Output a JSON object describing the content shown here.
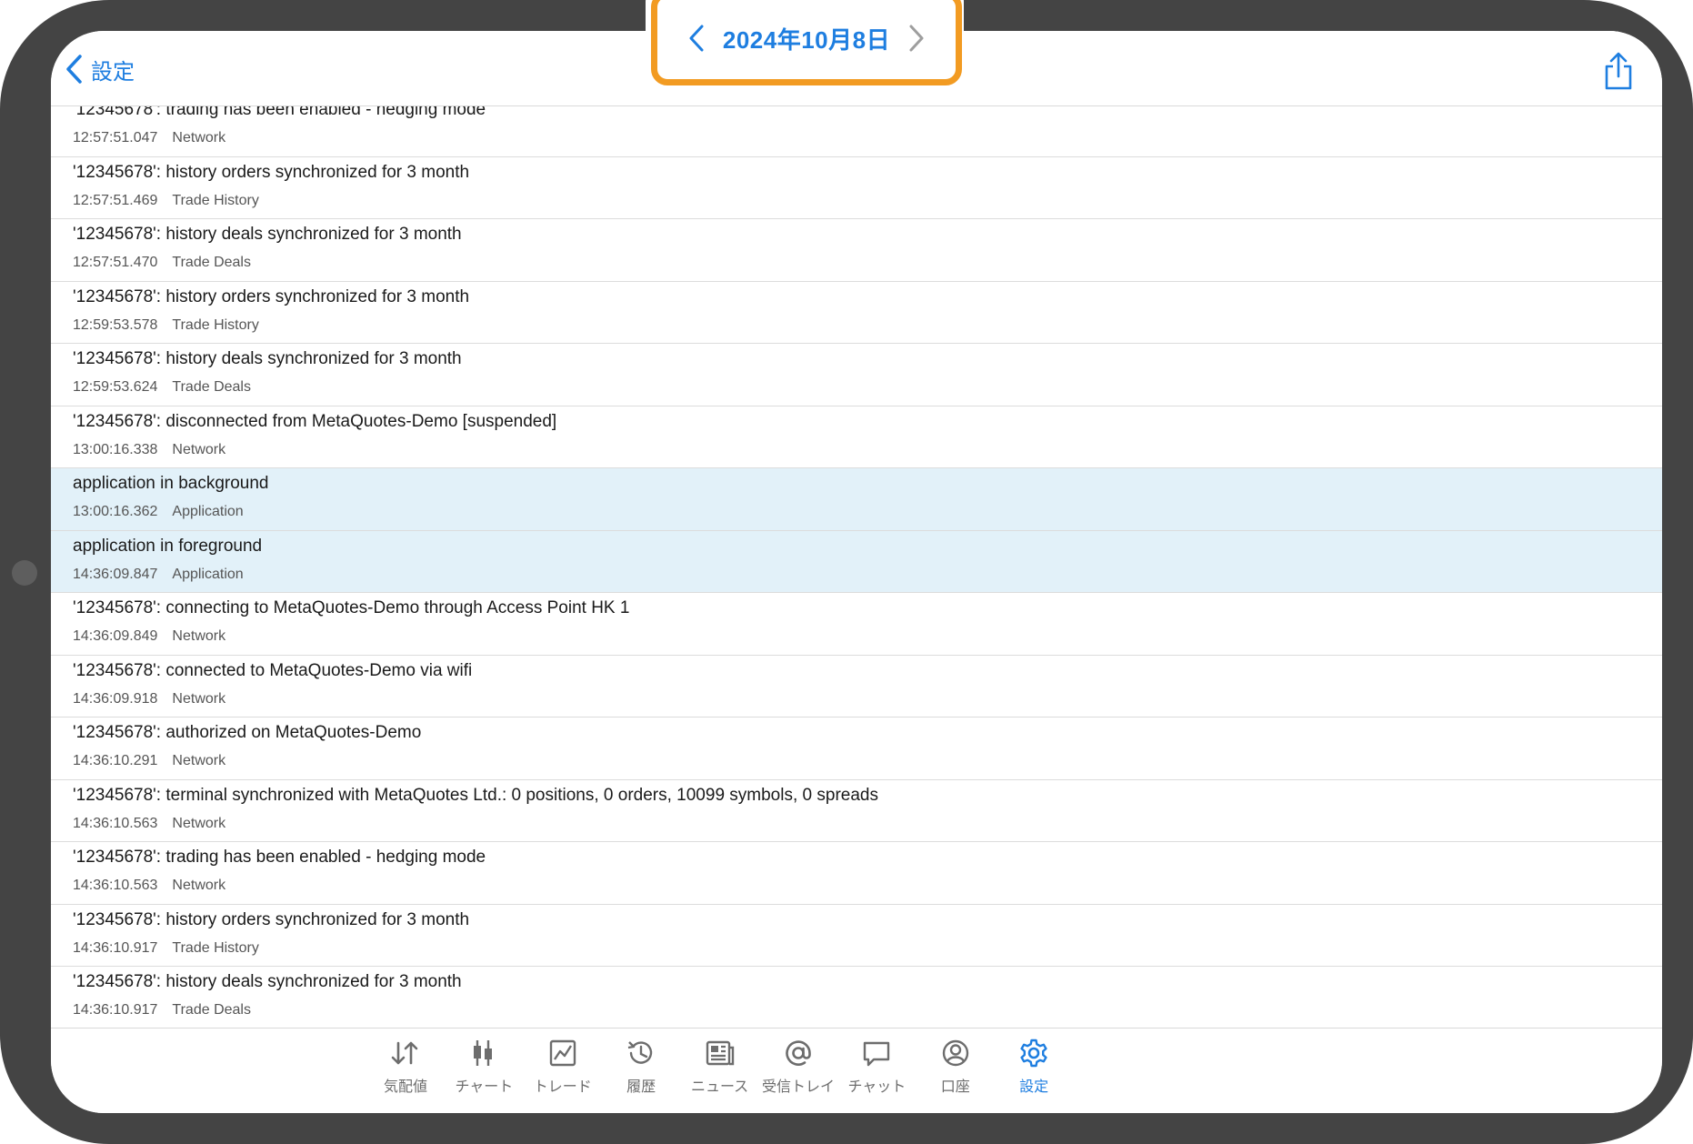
{
  "nav": {
    "back_label": "設定",
    "date": "2024年10月8日"
  },
  "logs": [
    {
      "message": "'12345678': trading has been enabled - hedging mode",
      "time": "12:57:51.047",
      "source": "Network",
      "highlighted": false
    },
    {
      "message": "'12345678': history orders synchronized for 3 month",
      "time": "12:57:51.469",
      "source": "Trade History",
      "highlighted": false
    },
    {
      "message": "'12345678': history deals synchronized for 3 month",
      "time": "12:57:51.470",
      "source": "Trade Deals",
      "highlighted": false
    },
    {
      "message": "'12345678': history orders synchronized for 3 month",
      "time": "12:59:53.578",
      "source": "Trade History",
      "highlighted": false
    },
    {
      "message": "'12345678': history deals synchronized for 3 month",
      "time": "12:59:53.624",
      "source": "Trade Deals",
      "highlighted": false
    },
    {
      "message": "'12345678': disconnected from MetaQuotes-Demo [suspended]",
      "time": "13:00:16.338",
      "source": "Network",
      "highlighted": false
    },
    {
      "message": "application in background",
      "time": "13:00:16.362",
      "source": "Application",
      "highlighted": true
    },
    {
      "message": "application in foreground",
      "time": "14:36:09.847",
      "source": "Application",
      "highlighted": true
    },
    {
      "message": "'12345678': connecting to MetaQuotes-Demo through Access Point HK 1",
      "time": "14:36:09.849",
      "source": "Network",
      "highlighted": false
    },
    {
      "message": "'12345678': connected to MetaQuotes-Demo via wifi",
      "time": "14:36:09.918",
      "source": "Network",
      "highlighted": false
    },
    {
      "message": "'12345678': authorized on MetaQuotes-Demo",
      "time": "14:36:10.291",
      "source": "Network",
      "highlighted": false
    },
    {
      "message": "'12345678': terminal synchronized with MetaQuotes Ltd.: 0 positions, 0 orders, 10099 symbols, 0 spreads",
      "time": "14:36:10.563",
      "source": "Network",
      "highlighted": false
    },
    {
      "message": "'12345678': trading has been enabled - hedging mode",
      "time": "14:36:10.563",
      "source": "Network",
      "highlighted": false
    },
    {
      "message": "'12345678': history orders synchronized for 3 month",
      "time": "14:36:10.917",
      "source": "Trade History",
      "highlighted": false
    },
    {
      "message": "'12345678': history deals synchronized for 3 month",
      "time": "14:36:10.917",
      "source": "Trade Deals",
      "highlighted": false
    }
  ],
  "tabs": [
    {
      "label": "気配値",
      "icon": "quotes-icon",
      "active": false
    },
    {
      "label": "チャート",
      "icon": "chart-icon",
      "active": false
    },
    {
      "label": "トレード",
      "icon": "trade-icon",
      "active": false
    },
    {
      "label": "履歴",
      "icon": "history-icon",
      "active": false
    },
    {
      "label": "ニュース",
      "icon": "news-icon",
      "active": false
    },
    {
      "label": "受信トレイ",
      "icon": "mailbox-icon",
      "active": false
    },
    {
      "label": "チャット",
      "icon": "chat-icon",
      "active": false
    },
    {
      "label": "口座",
      "icon": "account-icon",
      "active": false
    },
    {
      "label": "設定",
      "icon": "settings-icon",
      "active": true
    }
  ],
  "colors": {
    "accent": "#1e7ee0",
    "highlight_frame": "#f29b22",
    "selected_row": "#e2f1f9",
    "device_frame": "#444444"
  }
}
